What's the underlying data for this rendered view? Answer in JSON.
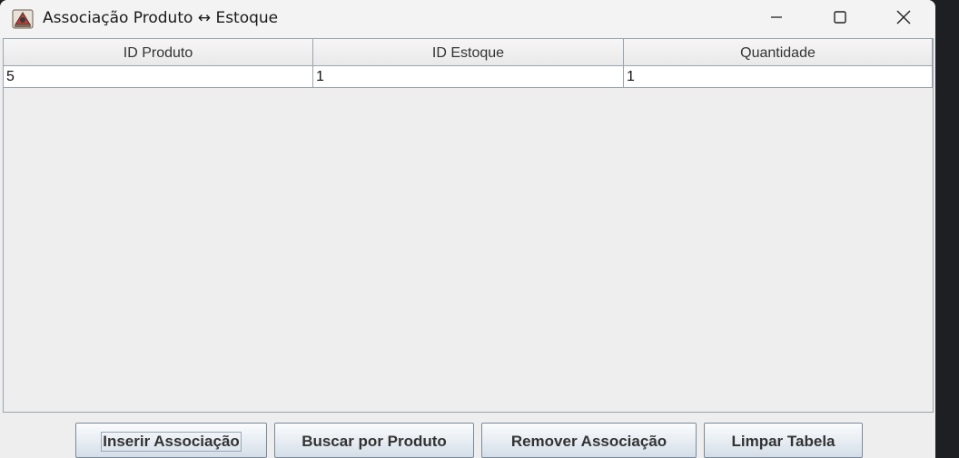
{
  "window": {
    "title": "Associação Produto ↔ Estoque",
    "app_icon": "java-app-icon",
    "controls": {
      "minimize": "minimize-icon",
      "maximize": "maximize-icon",
      "close": "close-icon"
    }
  },
  "table": {
    "columns": [
      "ID Produto",
      "ID Estoque",
      "Quantidade"
    ],
    "rows": [
      [
        "5",
        "1",
        "1"
      ]
    ]
  },
  "buttons": {
    "insert": "Inserir Associação",
    "search": "Buscar por Produto",
    "remove": "Remover Associação",
    "clear": "Limpar Tabela"
  }
}
